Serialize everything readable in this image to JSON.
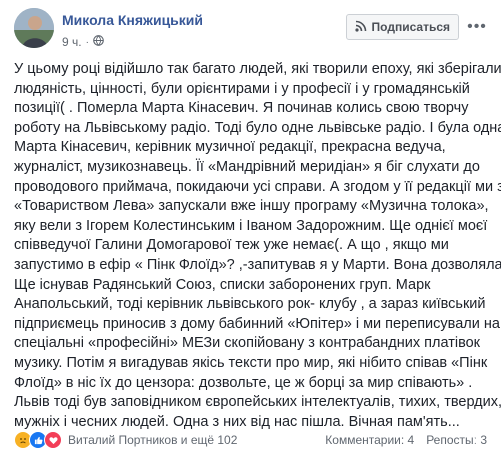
{
  "author": "Микола Княжицький",
  "time": "9 ч.",
  "subscribe_label": "Подписаться",
  "post_lines": [
    "У цьому році відійшло так багато людей, які творили епоху, які зберігали",
    "людяність, цінності, були орієнтирами і у професії і у громадянській",
    "позиції( . Померла Марта Кінасевич. Я починав колись свою творчу",
    "роботу на Львівському радіо. Тоді було одне львівське радіо. І була одна",
    "Марта Кінасевич, керівник музичної редакції, прекрасна ведуча,",
    "журналіст, музикознавець. Її «Мандрівний меридіан» я біг слухати до",
    "проводового приймача, покидаючи усі справи. А згодом у її редакції ми з",
    "«Товариством Лева» запускали вже іншу програму «Музична толока»,",
    "яку вели з Ігорем Колестинським і Іваном Задорожним. Ще однієї моєї",
    "співведучої Галини Домогарової теж уже немає(. А що , якщо ми",
    "запустимо в ефір « Пінк Флоїд»? ,-запитував я у Марти. Вона дозволяла.",
    "Ще існував Радянський Союз, списки заборонених груп. Марк",
    "Анапольський, тоді керівник львівського рок- клубу , а зараз київський",
    "підприємець приносив з дому бабинний «Юпітер» і ми переписували на",
    "спеціальні «професійні» МЕЗи скопійованy з контрабандних платівок",
    "музику. Потім я вигадував якісь тексти про мир, які нібито співав «Пінк",
    "Флоїд» в ніс їх до цензора: дозвольте, це ж борці за мир співають» .",
    "Львів тоді був заповідником європейських інтелектуалів, тихих, твердих,",
    "мужніх і чесних людей. Одна з них від нас пішла. Вічная пам'ять..."
  ],
  "reactions": {
    "names": "Виталий Портников и ещё 102",
    "icons": [
      "sad-icon",
      "like-icon",
      "love-icon"
    ]
  },
  "stats": {
    "comments": "Комментарии: 4",
    "shares": "Репостыː 3"
  },
  "colors": {
    "author": "#385898",
    "text": "#1d2129",
    "meta": "#606770",
    "like": "#1877f2",
    "love": "#f33e58",
    "sad": "#f7b125"
  }
}
